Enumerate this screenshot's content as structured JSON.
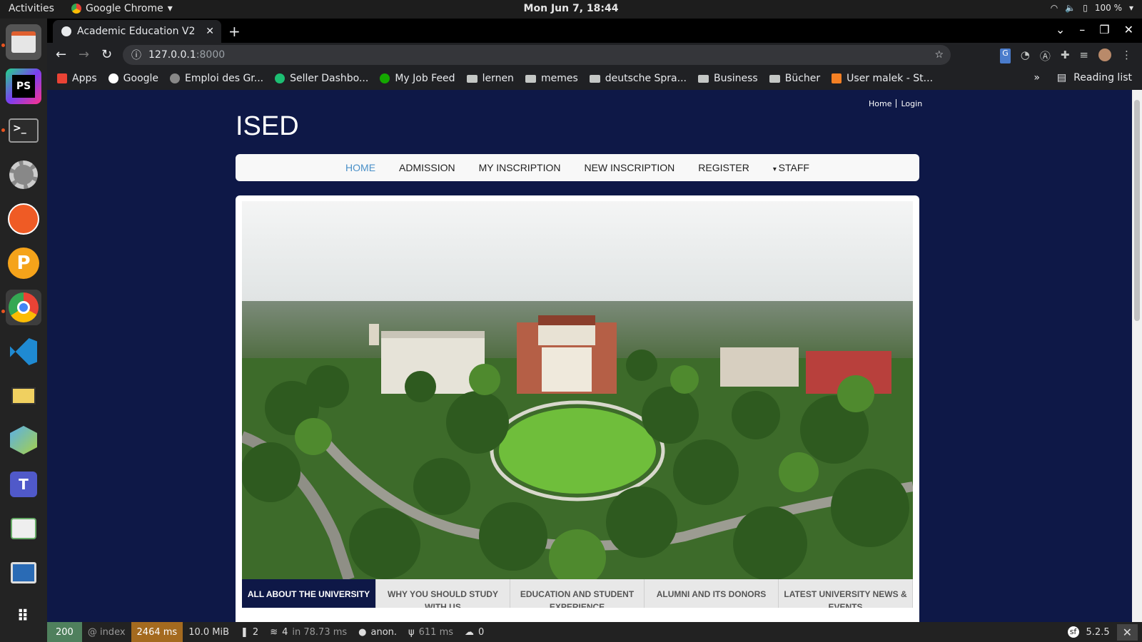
{
  "system": {
    "activities": "Activities",
    "app_name": "Google Chrome",
    "clock": "Mon Jun  7, 18:44",
    "battery": "100 %"
  },
  "dock": {
    "apps": [
      "files",
      "phpstorm",
      "terminal",
      "settings",
      "postman",
      "plex",
      "chrome",
      "vscode",
      "mail-search",
      "virtualbox",
      "teams",
      "image-viewer",
      "presentation",
      "app-grid"
    ],
    "phpstorm_label": "PS",
    "teams_label": "T"
  },
  "browser": {
    "tab_title": "Academic Education V2",
    "url_host": "127.0.0.1",
    "url_port": ":8000",
    "bookmarks": [
      {
        "label": "Apps",
        "icon": "apps-grid-icon"
      },
      {
        "label": "Google",
        "icon": "google-icon"
      },
      {
        "label": "Emploi des Gr...",
        "icon": "site-icon"
      },
      {
        "label": "Seller Dashbo...",
        "icon": "fiverr-icon"
      },
      {
        "label": "My Job Feed",
        "icon": "upwork-icon"
      },
      {
        "label": "lernen",
        "icon": "folder-icon"
      },
      {
        "label": "memes",
        "icon": "folder-icon"
      },
      {
        "label": "deutsche Spra...",
        "icon": "folder-icon"
      },
      {
        "label": "Business",
        "icon": "folder-icon"
      },
      {
        "label": "Bücher",
        "icon": "folder-icon"
      },
      {
        "label": "User malek - St...",
        "icon": "stackoverflow-icon"
      }
    ],
    "reading_list": "Reading list",
    "overflow": "»"
  },
  "page": {
    "toplinks": {
      "home": "Home",
      "login": "Login"
    },
    "brand": "ISED",
    "nav": [
      {
        "label": "HOME",
        "active": true
      },
      {
        "label": "ADMISSION",
        "active": false
      },
      {
        "label": "MY INSCRIPTION",
        "active": false
      },
      {
        "label": "NEW INSCRIPTION",
        "active": false
      },
      {
        "label": "REGISTER",
        "active": false
      },
      {
        "label": "STAFF",
        "active": false,
        "dropdown": true
      }
    ],
    "slider_tabs": [
      {
        "label": "ALL ABOUT THE UNIVERSITY",
        "active": true
      },
      {
        "label": "WHY YOU SHOULD STUDY WITH US",
        "active": false
      },
      {
        "label": "EDUCATION AND STUDENT EXPERIENCE",
        "active": false
      },
      {
        "label": "ALUMNI AND ITS DONORS",
        "active": false
      },
      {
        "label": "LATEST UNIVERSITY NEWS & EVENTS",
        "active": false
      }
    ]
  },
  "debug": {
    "status": "200",
    "route": "@ index",
    "time": "2464 ms",
    "memory": "10.0 MiB",
    "logs": "2",
    "db": "4",
    "db_time": "in 78.73 ms",
    "user": "anon.",
    "render": "611 ms",
    "uploads": "0",
    "version": "5.2.5",
    "status_color": "#4f805d",
    "time_color": "#a46a1f"
  }
}
